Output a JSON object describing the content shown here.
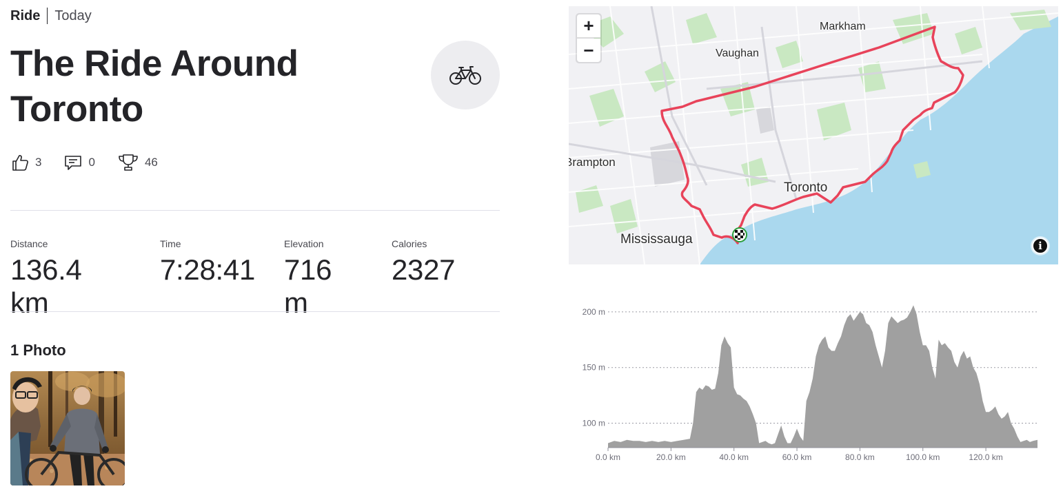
{
  "activity": {
    "type": "Ride",
    "when": "Today",
    "title": "The Ride Around Toronto",
    "sport_icon": "bicycle-icon"
  },
  "social": {
    "kudos": {
      "icon": "thumbs-up-icon",
      "count": "3"
    },
    "comments": {
      "icon": "comment-icon",
      "count": "0"
    },
    "achievements": {
      "icon": "trophy-icon",
      "count": "46"
    }
  },
  "stats": [
    {
      "label": "Distance",
      "value": "136.4 km"
    },
    {
      "label": "Time",
      "value": "7:28:41"
    },
    {
      "label": "Elevation",
      "value": "716 m"
    },
    {
      "label": "Calories",
      "value": "2327"
    }
  ],
  "photos": {
    "title": "1 Photo"
  },
  "map": {
    "zoom_in": "+",
    "zoom_out": "−",
    "info": "i",
    "labels": {
      "markham": "Markham",
      "vaughan": "Vaughan",
      "brampton": "Brampton",
      "toronto": "Toronto",
      "mississauga": "Mississauga"
    },
    "route_color": "#e8435a",
    "water_color": "#aad8ee",
    "land_color": "#f1f1f4",
    "park_color": "#c9e8c2"
  },
  "chart_data": {
    "type": "area",
    "xlabel": "",
    "ylabel": "",
    "x_unit": "km",
    "y_unit": "m",
    "x_ticks": [
      "0.0 km",
      "20.0 km",
      "40.0 km",
      "60.0 km",
      "80.0 km",
      "100.0 km",
      "120.0 km"
    ],
    "y_ticks": [
      "100 m",
      "150 m",
      "200 m"
    ],
    "xlim": [
      0,
      136.4
    ],
    "ylim": [
      78,
      208
    ],
    "grid": true,
    "fill_color": "#a0a0a0",
    "x": [
      0,
      2,
      4,
      6,
      8,
      10,
      12,
      14,
      16,
      18,
      20,
      22,
      24,
      26,
      27,
      28,
      29,
      30,
      31,
      32,
      33,
      34,
      35,
      36,
      37,
      38,
      39,
      40,
      41,
      42,
      43,
      44,
      45,
      46,
      47,
      48,
      49,
      50,
      51,
      52,
      53,
      54,
      55,
      56,
      57,
      58,
      59,
      60,
      61,
      62,
      63,
      64,
      65,
      66,
      67,
      68,
      69,
      70,
      71,
      72,
      73,
      74,
      75,
      76,
      77,
      78,
      79,
      80,
      81,
      82,
      83,
      84,
      85,
      86,
      87,
      88,
      89,
      90,
      91,
      92,
      93,
      94,
      95,
      96,
      97,
      98,
      99,
      100,
      101,
      102,
      103,
      104,
      105,
      106,
      107,
      108,
      109,
      110,
      111,
      112,
      113,
      114,
      115,
      116,
      117,
      118,
      119,
      120,
      121,
      122,
      123,
      124,
      125,
      126,
      127,
      128,
      129,
      130,
      131,
      132,
      133,
      134,
      135,
      136.4
    ],
    "values": [
      82,
      84,
      83,
      85,
      84,
      84,
      83,
      84,
      83,
      84,
      83,
      84,
      85,
      86,
      100,
      128,
      132,
      130,
      134,
      133,
      130,
      131,
      145,
      170,
      178,
      172,
      168,
      132,
      126,
      125,
      122,
      120,
      115,
      108,
      100,
      82,
      83,
      84,
      82,
      81,
      82,
      90,
      98,
      88,
      82,
      82,
      88,
      95,
      88,
      84,
      120,
      128,
      140,
      160,
      170,
      175,
      178,
      168,
      165,
      165,
      172,
      178,
      188,
      195,
      198,
      192,
      196,
      200,
      198,
      190,
      188,
      182,
      170,
      160,
      150,
      165,
      190,
      196,
      193,
      190,
      192,
      193,
      195,
      200,
      206,
      198,
      182,
      170,
      170,
      165,
      150,
      140,
      175,
      170,
      172,
      168,
      165,
      155,
      150,
      160,
      165,
      158,
      160,
      150,
      145,
      135,
      120,
      110,
      110,
      112,
      115,
      108,
      104,
      106,
      110,
      100,
      95,
      88,
      83,
      84,
      85,
      83,
      84,
      85
    ]
  }
}
